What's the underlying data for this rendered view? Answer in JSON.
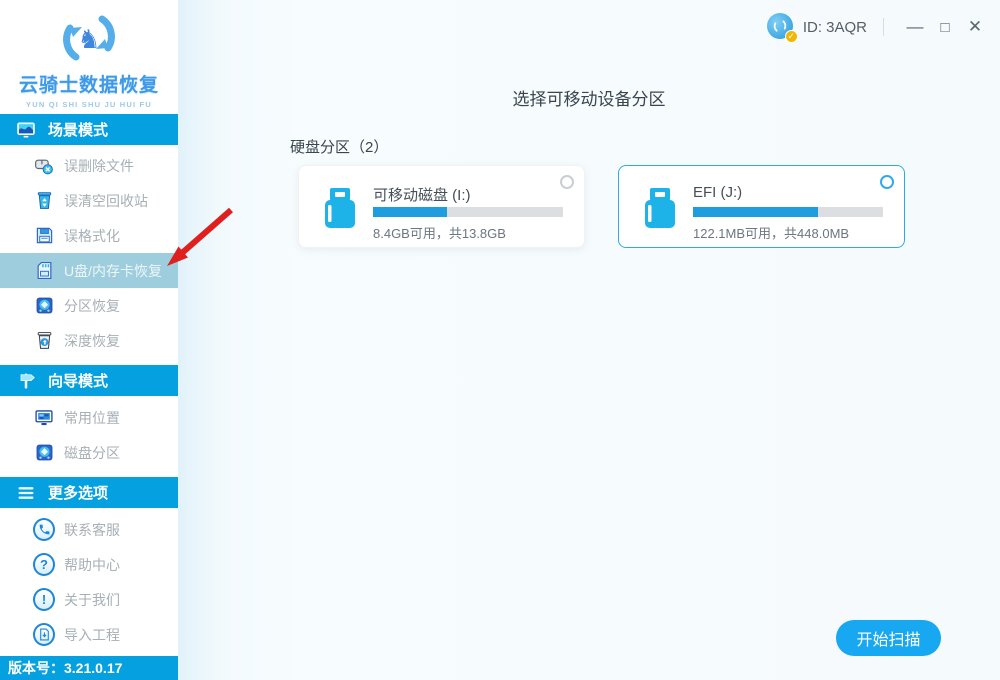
{
  "window": {
    "id_label": "ID: 3AQR",
    "controls": {
      "minimize": "—",
      "maximize": "□",
      "close": "✕"
    }
  },
  "sidebar": {
    "logo": {
      "title": "云骑士数据恢复",
      "subtitle": "YUN QI SHI SHU JU HUI FU"
    },
    "sections": [
      {
        "label": "场景模式",
        "icon": "scene-mode-icon",
        "items": [
          {
            "label": "误删除文件",
            "icon": "deleted-file-icon",
            "selected": false
          },
          {
            "label": "误清空回收站",
            "icon": "recycle-bin-icon",
            "selected": false
          },
          {
            "label": "误格式化",
            "icon": "format-icon",
            "selected": false
          },
          {
            "label": "U盘/内存卡恢复",
            "icon": "usb-sd-card-icon",
            "selected": true
          },
          {
            "label": "分区恢复",
            "icon": "partition-recovery-icon",
            "selected": false
          },
          {
            "label": "深度恢复",
            "icon": "deep-recovery-icon",
            "selected": false
          }
        ]
      },
      {
        "label": "向导模式",
        "icon": "wizard-mode-icon",
        "items": [
          {
            "label": "常用位置",
            "icon": "common-location-icon",
            "selected": false
          },
          {
            "label": "磁盘分区",
            "icon": "disk-partition-icon",
            "selected": false
          }
        ]
      },
      {
        "label": "更多选项",
        "icon": "more-options-icon",
        "items": [
          {
            "label": "联系客服",
            "icon": "contact-support-icon",
            "glyph": "",
            "selected": false
          },
          {
            "label": "帮助中心",
            "icon": "help-center-icon",
            "glyph": "?",
            "selected": false
          },
          {
            "label": "关于我们",
            "icon": "about-us-icon",
            "glyph": "!",
            "selected": false
          },
          {
            "label": "导入工程",
            "icon": "import-project-icon",
            "glyph": "",
            "selected": false
          }
        ]
      }
    ],
    "version": "版本号：3.21.0.17"
  },
  "main": {
    "title": "选择可移动设备分区",
    "group_label": "硬盘分区（2）",
    "cards": [
      {
        "name": "可移动磁盘 (I:)",
        "usage_percent": 39,
        "detail": "8.4GB可用，共13.8GB",
        "selected": false
      },
      {
        "name": "EFI (J:)",
        "usage_percent": 66,
        "detail": "122.1MB可用，共448.0MB",
        "selected": true
      }
    ],
    "scan_button": "开始扫描"
  },
  "annotation": {
    "type": "red-arrow",
    "points_to": "U盘/内存卡恢复"
  },
  "colors": {
    "accent_blue": "#05a0e0",
    "button_blue": "#18a8f2",
    "progress_fill": "#1e9ddf",
    "selected_item_bg": "#9ecddd",
    "selected_card_border": "#2fa9ec",
    "arrow_red": "#e01f1f"
  }
}
